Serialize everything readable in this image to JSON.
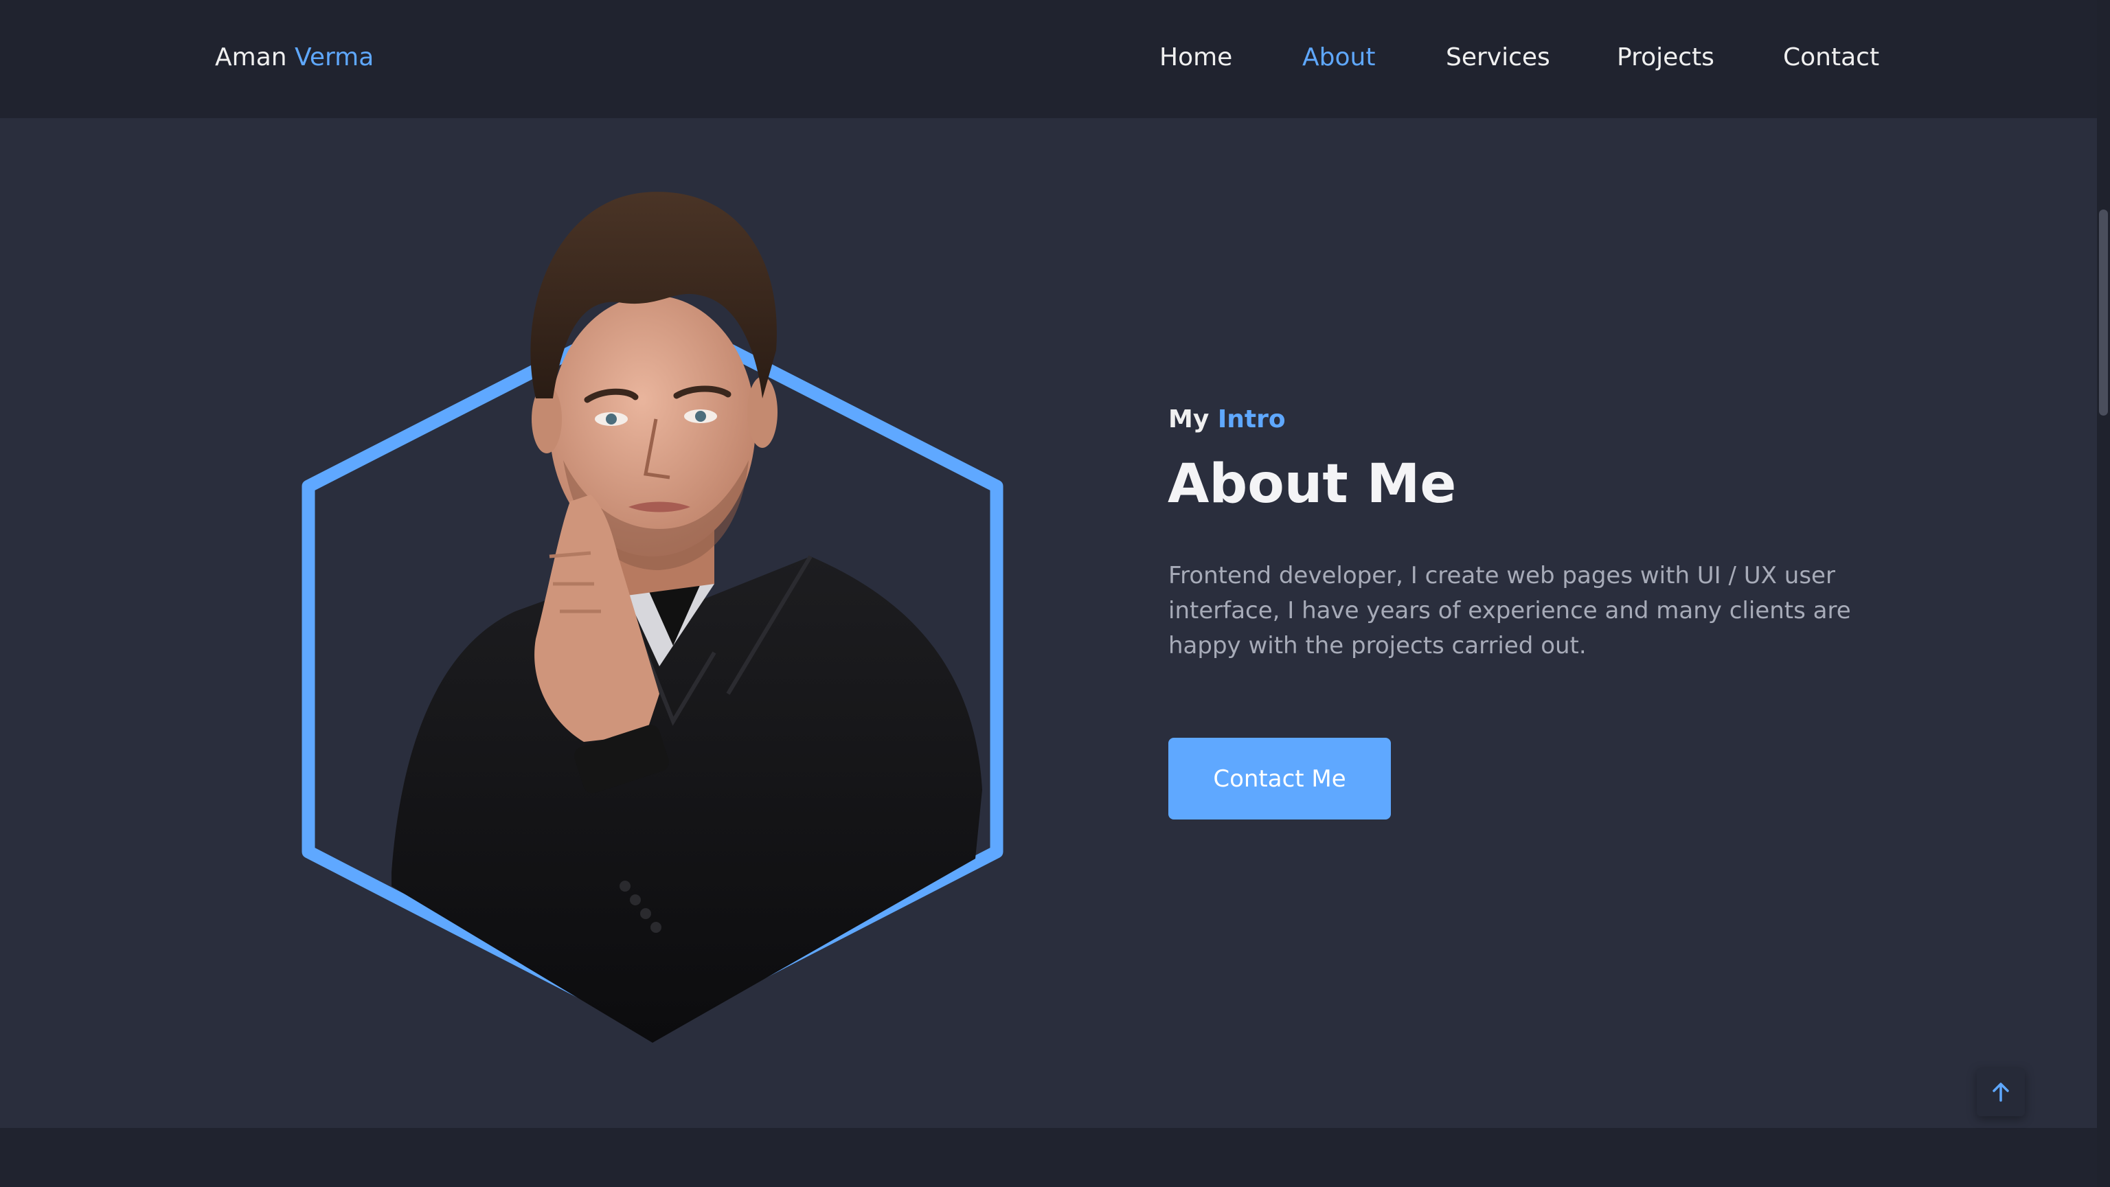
{
  "brand": {
    "first": "Aman",
    "last": "Verma"
  },
  "nav": {
    "items": [
      {
        "label": "Home"
      },
      {
        "label": "About"
      },
      {
        "label": "Services"
      },
      {
        "label": "Projects"
      },
      {
        "label": "Contact"
      }
    ],
    "active": "About"
  },
  "about": {
    "subtitle_prefix": "My",
    "subtitle_accent": "Intro",
    "title": "About Me",
    "description": "Frontend developer, I create web pages with UI / UX user interface, I have years of experience and many clients are happy with the projects carried out.",
    "cta_label": "Contact Me"
  },
  "icons": {
    "scroll_top": "arrow-up-icon",
    "portrait": "portrait-image"
  },
  "colors": {
    "accent": "#5fa8ff",
    "nav_bg": "#20232f",
    "section_bg": "#2a2e3d",
    "text": "#f0f0f0",
    "muted_text": "#a7abb8"
  }
}
